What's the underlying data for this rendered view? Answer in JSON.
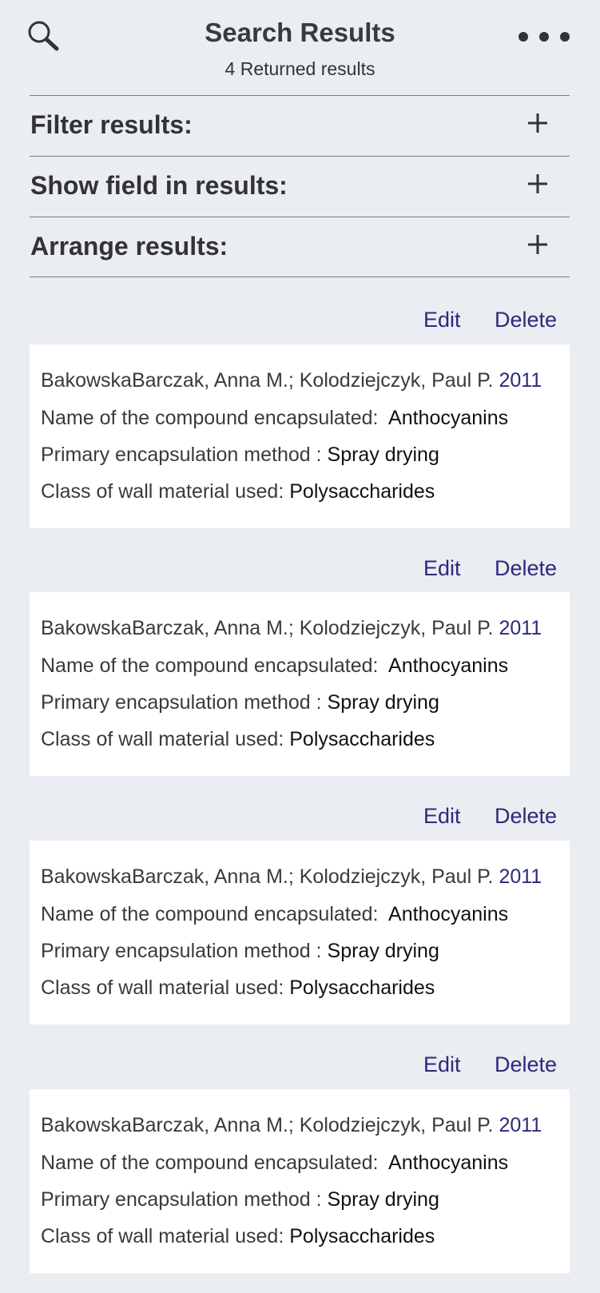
{
  "header": {
    "title": "Search Results",
    "subtitle": "4 Returned results",
    "search_icon": "search-icon",
    "more_icon": "more-horizontal-icon"
  },
  "sections": [
    {
      "label": "Filter results:",
      "icon": "plus-icon"
    },
    {
      "label": "Show field in results:",
      "icon": "plus-icon"
    },
    {
      "label": "Arrange results:",
      "icon": "plus-icon"
    }
  ],
  "colors": {
    "background": "#eaedf2",
    "card": "#ffffff",
    "link": "#2b2a7a",
    "text": "#333333"
  },
  "results": [
    {
      "edit_label": "Edit",
      "delete_label": "Delete",
      "authors": "BakowskaBarczak, Anna M.; Kolodziejczyk, Paul P.",
      "year": "2011",
      "compound_label": "Name of the compound encapsulated:",
      "compound_value": "Anthocyanins",
      "method_label": "Primary encapsulation method :",
      "method_value": "Spray drying",
      "wall_label": "Class of wall material used:",
      "wall_value": "Polysaccharides"
    },
    {
      "edit_label": "Edit",
      "delete_label": "Delete",
      "authors": "BakowskaBarczak, Anna M.; Kolodziejczyk, Paul P.",
      "year": "2011",
      "compound_label": "Name of the compound encapsulated:",
      "compound_value": "Anthocyanins",
      "method_label": "Primary encapsulation method :",
      "method_value": "Spray drying",
      "wall_label": "Class of wall material used:",
      "wall_value": "Polysaccharides"
    },
    {
      "edit_label": "Edit",
      "delete_label": "Delete",
      "authors": "BakowskaBarczak, Anna M.; Kolodziejczyk, Paul P.",
      "year": "2011",
      "compound_label": "Name of the compound encapsulated:",
      "compound_value": "Anthocyanins",
      "method_label": "Primary encapsulation method :",
      "method_value": "Spray drying",
      "wall_label": "Class of wall material used:",
      "wall_value": "Polysaccharides"
    },
    {
      "edit_label": "Edit",
      "delete_label": "Delete",
      "authors": "BakowskaBarczak, Anna M.; Kolodziejczyk, Paul P.",
      "year": "2011",
      "compound_label": "Name of the compound encapsulated:",
      "compound_value": "Anthocyanins",
      "method_label": "Primary encapsulation method :",
      "method_value": "Spray drying",
      "wall_label": "Class of wall material used:",
      "wall_value": "Polysaccharides"
    }
  ]
}
